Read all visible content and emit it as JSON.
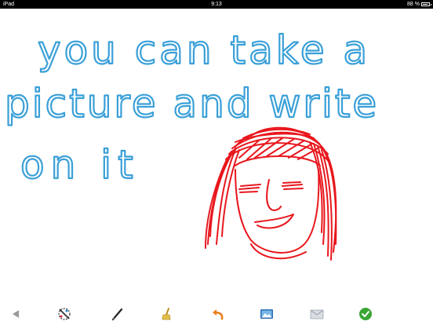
{
  "status_bar": {
    "carrier": "iPad",
    "time": "9:13",
    "battery_text": "88 %",
    "battery_level": 0.88
  },
  "canvas": {
    "ink_colors": {
      "text": "#3aa0d8",
      "face": "#e8171d"
    },
    "handwriting": {
      "line1": "you can take a",
      "line2": "picture and write",
      "line3": "on it"
    }
  },
  "toolbar": {
    "tools": [
      {
        "name": "back-arrow-icon"
      },
      {
        "name": "color-palette-icon"
      },
      {
        "name": "pen-icon"
      },
      {
        "name": "eraser-broom-icon"
      },
      {
        "name": "undo-arrow-icon"
      },
      {
        "name": "photo-icon"
      },
      {
        "name": "mail-icon"
      },
      {
        "name": "checkmark-done-icon"
      }
    ]
  }
}
